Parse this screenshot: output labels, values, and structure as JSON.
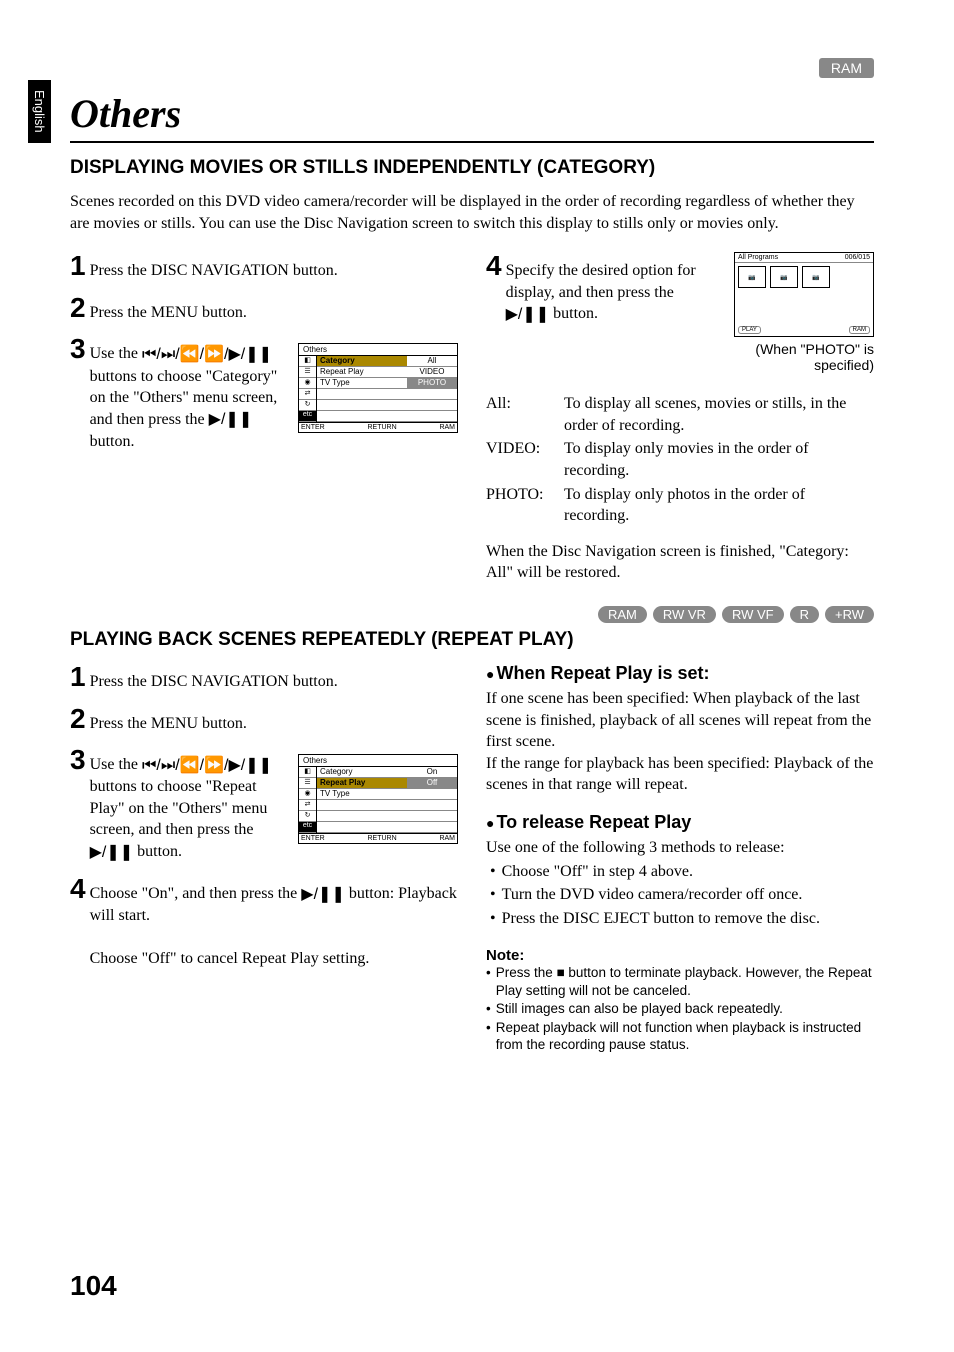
{
  "sideTab": "English",
  "topBadge": "RAM",
  "title": "Others",
  "section1": {
    "heading": "DISPLAYING MOVIES OR STILLS INDEPENDENTLY (CATEGORY)",
    "intro": "Scenes recorded on this DVD video camera/recorder will be displayed in the order of recording regardless of whether they are movies or stills. You can use the Disc Navigation screen to switch this display to stills only or movies only.",
    "left": {
      "s1": "Press the DISC NAVIGATION button.",
      "s2": "Press the MENU button.",
      "s3a": "Use the ",
      "s3icons": "⏮/⏭/⏪/⏩/▶/❚❚",
      "s3b": " buttons to choose \"Category\" on the \"Others\" menu screen, and then press the ",
      "s3icon2": "▶/❚❚",
      "s3c": " button.",
      "menu": {
        "title": "Others",
        "rows": [
          {
            "label": "Category",
            "val": "All"
          },
          {
            "label": "Repeat Play",
            "val": "VIDEO"
          },
          {
            "label": "TV Type",
            "val": "PHOTO"
          }
        ],
        "footerEnter": "ENTER",
        "footerReturn": "RETURN",
        "footerRam": "RAM"
      }
    },
    "right": {
      "s4a": "Specify the desired option for display, and then press the ",
      "s4icon": "▶/❚❚",
      "s4b": " button.",
      "screen": {
        "topLeft": "All Programs",
        "topRight": "006/015",
        "bottomLeft": "PLAY",
        "bottomRight": "RAM"
      },
      "caption": "(When \"PHOTO\" is specified)",
      "defs": [
        {
          "label": "All:",
          "text": "To display all scenes, movies or stills, in the order of recording."
        },
        {
          "label": "VIDEO:",
          "text": "To display only movies in the order of recording."
        },
        {
          "label": "PHOTO:",
          "text": "To display only photos in the order of recording."
        }
      ],
      "restore": "When the Disc Navigation screen is finished, \"Category: All\" will be restored."
    }
  },
  "badges": [
    "RAM",
    "RW VR",
    "RW VF",
    "R",
    "+RW"
  ],
  "section2": {
    "heading": "PLAYING BACK SCENES REPEATEDLY (REPEAT PLAY)",
    "left": {
      "s1": "Press the DISC NAVIGATION button.",
      "s2": "Press the MENU button.",
      "s3a": "Use the ",
      "s3icons": "⏮/⏭/⏪/⏩/▶/❚❚",
      "s3b": " buttons to choose \"Repeat Play\" on the \"Others\" menu screen, and then press the ",
      "s3icon2": "▶/❚❚",
      "s3c": " button.",
      "menu": {
        "title": "Others",
        "rows": [
          {
            "label": "Category",
            "val": "On"
          },
          {
            "label": "Repeat Play",
            "val": "Off"
          },
          {
            "label": "TV Type",
            "val": ""
          }
        ],
        "footerEnter": "ENTER",
        "footerReturn": "RETURN",
        "footerRam": "RAM"
      },
      "s4a": "Choose \"On\", and then press the ",
      "s4icon": "▶/❚❚",
      "s4b": " button: Playback will start.",
      "s4c": "Choose \"Off\" to cancel Repeat Play setting."
    },
    "right": {
      "h1": "When Repeat Play is set:",
      "p1": "If one scene has been specified: When playback of the last scene is finished, playback of all scenes will repeat from the first scene.",
      "p2": "If the range for playback has been specified: Playback of the scenes in that range will repeat.",
      "h2": "To release Repeat Play",
      "p3": "Use one of the following 3 methods to release:",
      "bullets": [
        "Choose \"Off\" in step 4 above.",
        "Turn the DVD video camera/recorder off once.",
        "Press the DISC EJECT button to remove the disc."
      ],
      "noteHead": "Note:",
      "notes": [
        "Press the ■ button to terminate playback. However, the Repeat Play setting will not be canceled.",
        "Still images can also be played back repeatedly.",
        "Repeat playback will not function when playback is instructed from the recording pause status."
      ]
    }
  },
  "pageNum": "104"
}
